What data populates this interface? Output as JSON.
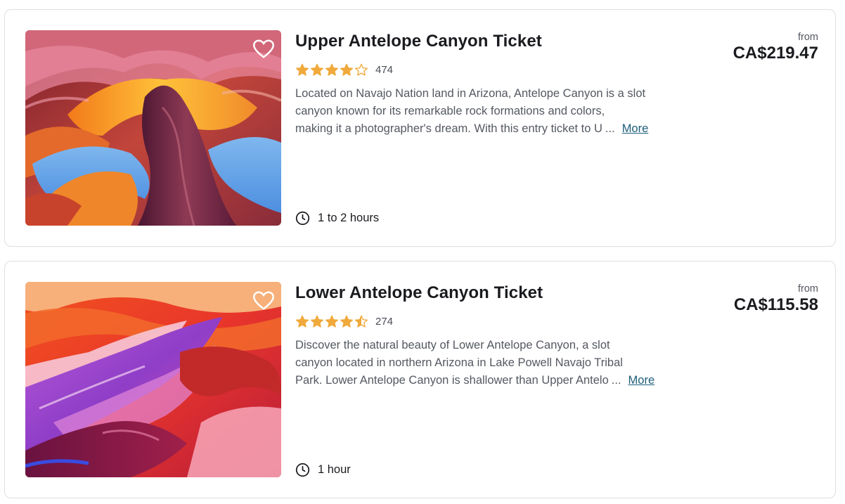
{
  "colors": {
    "star_filled": "#f0a93b",
    "star_empty": "#f0a93b",
    "more_link": "#1d5d78",
    "border": "#dcdfe4"
  },
  "icons": {
    "wishlist": "heart-outline-icon",
    "duration": "clock-icon",
    "rating": "star-icon"
  },
  "products": [
    {
      "title": "Upper Antelope Canyon Ticket",
      "rating": 4.0,
      "rating_count": "474",
      "description_lines": [
        "Located on Navajo Nation land in Arizona, Antelope Canyon is a slot",
        "canyon known for its remarkable rock formations and colors,",
        "making it a photographer's dream. With this entry ticket to U"
      ],
      "ellipsis": "...",
      "more_label": "More",
      "duration": "1 to 2 hours",
      "price_prefix": "from",
      "price": "CA$219.47"
    },
    {
      "title": "Lower Antelope Canyon Ticket",
      "rating": 4.5,
      "rating_count": "274",
      "description_lines": [
        "Discover the natural beauty of Lower Antelope Canyon, a slot",
        "canyon located in northern Arizona in Lake Powell Navajo Tribal",
        "Park. Lower Antelope Canyon is shallower than Upper Antelo"
      ],
      "ellipsis": "...",
      "more_label": "More",
      "duration": "1 hour",
      "price_prefix": "from",
      "price": "CA$115.58"
    }
  ]
}
